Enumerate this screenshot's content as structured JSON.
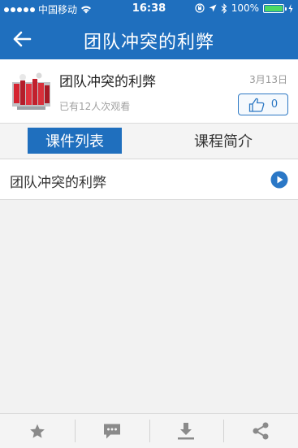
{
  "status_bar": {
    "carrier": "中国移动",
    "time": "16:38",
    "battery": "100%"
  },
  "navbar": {
    "title": "团队冲突的利弊",
    "back_icon": "back-arrow-icon"
  },
  "course": {
    "title": "团队冲突的利弊",
    "date": "3月13日",
    "views": "已有12人次观看",
    "likes": "0"
  },
  "tabs": [
    {
      "label": "课件列表",
      "active": true
    },
    {
      "label": "课程简介",
      "active": false
    }
  ],
  "lessons": [
    {
      "title": "团队冲突的利弊",
      "icon": "play-icon"
    }
  ],
  "toolbar": {
    "items": [
      "star-icon",
      "comment-icon",
      "download-icon",
      "share-icon"
    ]
  },
  "colors": {
    "primary": "#1f6fbe",
    "play": "#2a77c6"
  }
}
